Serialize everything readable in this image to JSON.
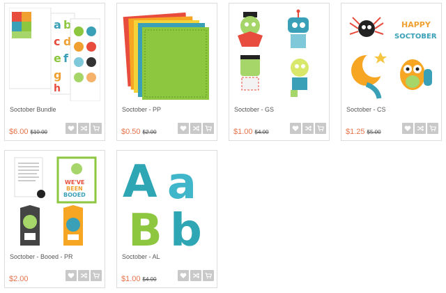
{
  "products": [
    {
      "title": "Soctober Bundle",
      "price": "$6.00",
      "old_price": "$10.00",
      "thumb": "bundle"
    },
    {
      "title": "Soctober - PP",
      "price": "$0.50",
      "old_price": "$2.00",
      "thumb": "papers"
    },
    {
      "title": "Soctober - GS",
      "price": "$1.00",
      "old_price": "$4.00",
      "thumb": "monsters"
    },
    {
      "title": "Soctober - CS",
      "price": "$1.25",
      "old_price": "$5.00",
      "thumb": "critters"
    },
    {
      "title": "Soctober - Booed - PR",
      "price": "$2.00",
      "old_price": "",
      "thumb": "booed"
    },
    {
      "title": "Soctober - AL",
      "price": "$1.00",
      "old_price": "$4.00",
      "thumb": "letters"
    }
  ],
  "thumb_text": {
    "happy_soctober": [
      "HAPPY",
      "SOCTOBER"
    ],
    "booed": [
      "WE'VE",
      "BEEN",
      "BOOED"
    ],
    "bundle_letters": [
      "a",
      "b",
      "c",
      "d",
      "e",
      "f",
      "g",
      "h"
    ],
    "alpha_letters": [
      "A",
      "a",
      "B",
      "b"
    ]
  },
  "icons": {
    "wishlist": "heart-icon",
    "compare": "shuffle-icon",
    "cart": "cart-icon"
  },
  "colors": {
    "price": "#e8734a",
    "button": "#c9c9c9",
    "border": "#dcdcdc",
    "title": "#555555"
  }
}
